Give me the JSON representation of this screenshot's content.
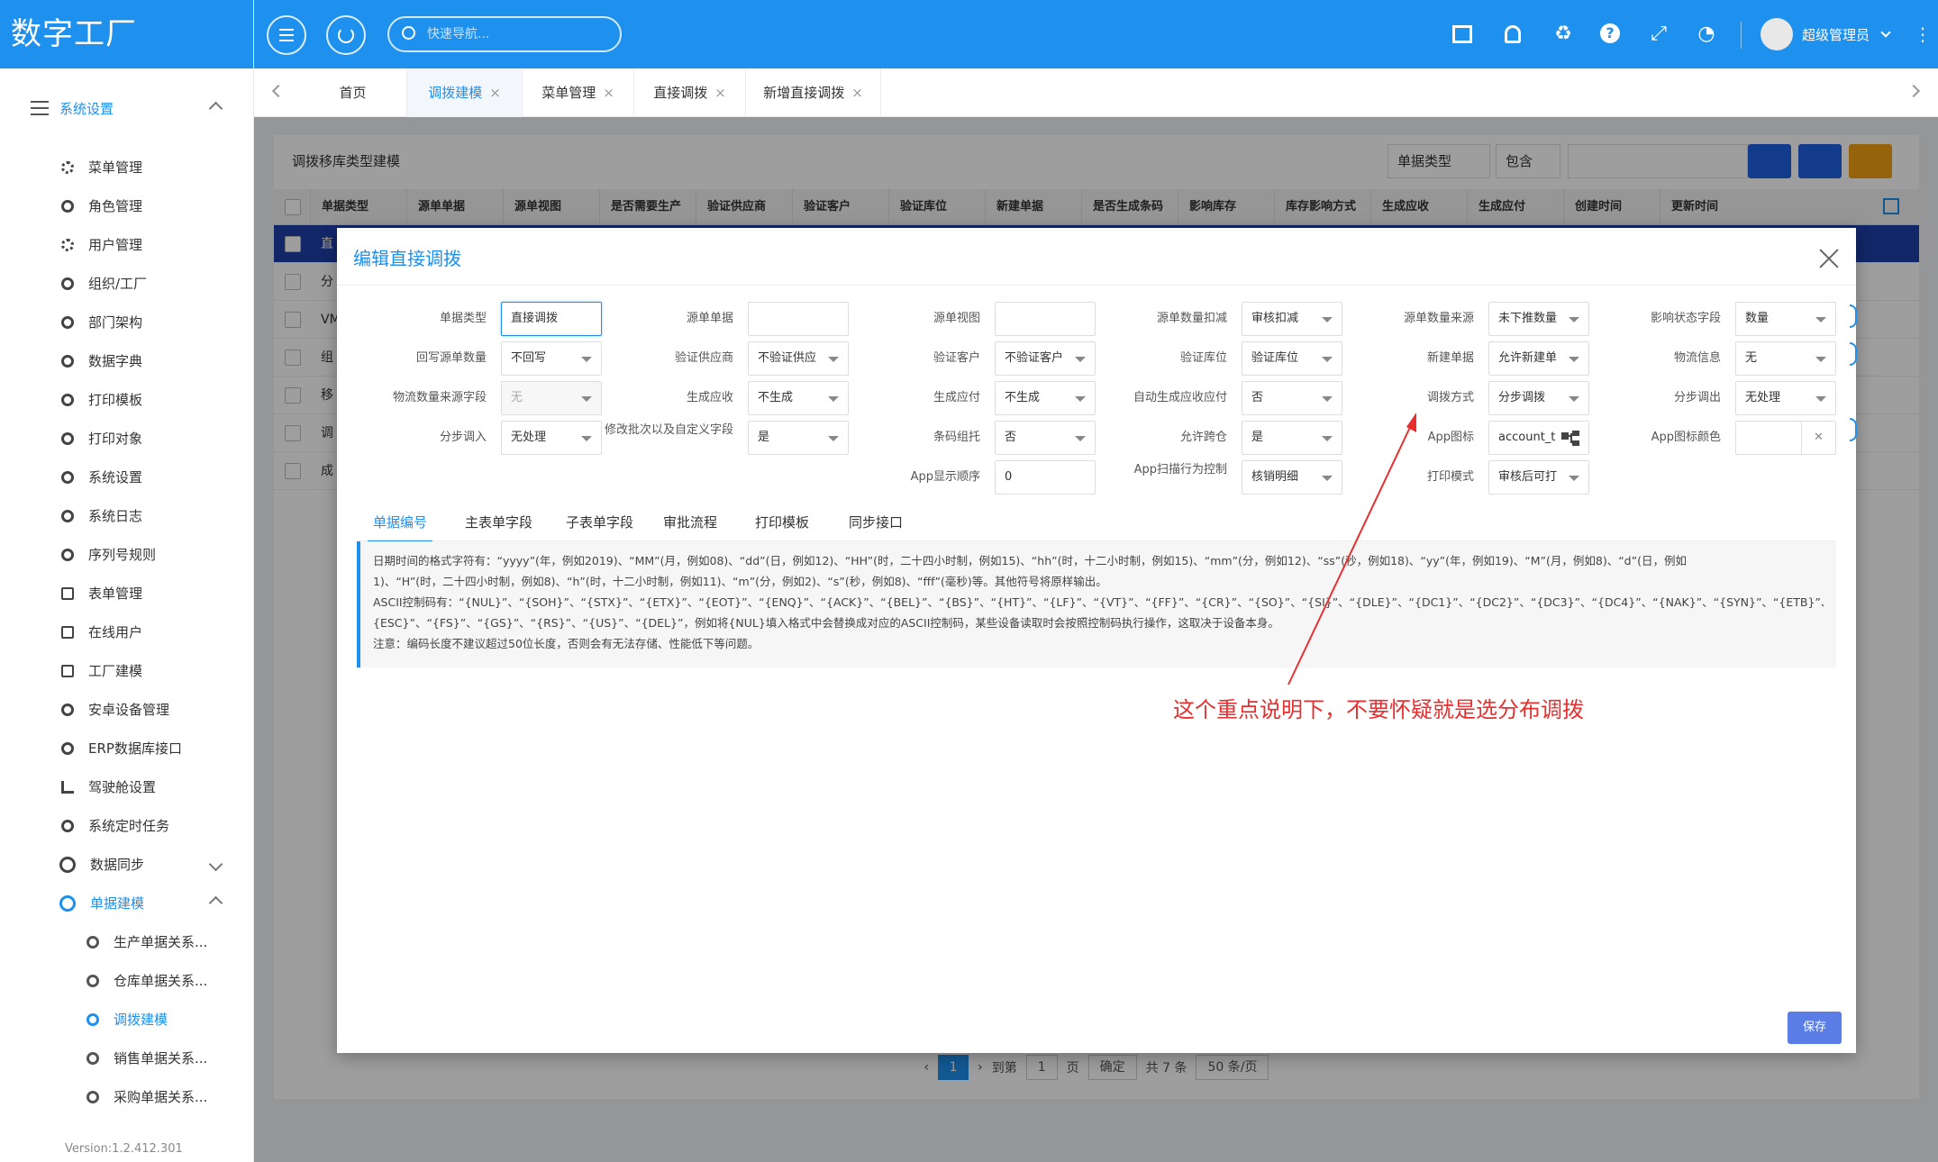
{
  "app": {
    "title": "数字工厂",
    "version": "Version:1.2.412.301"
  },
  "topbar": {
    "search_placeholder": "快速导航...",
    "user_name": "超级管理员"
  },
  "sidebar": {
    "group_label": "系统设置",
    "items": [
      "菜单管理",
      "角色管理",
      "用户管理",
      "组织/工厂",
      "部门架构",
      "数据字典",
      "打印模板",
      "打印对象",
      "系统设置",
      "系统日志",
      "序列号规则",
      "表单管理",
      "在线用户",
      "工厂建模",
      "安卓设备管理",
      "ERP数据库接口",
      "驾驶舱设置",
      "系统定时任务"
    ],
    "data_sync": "数据同步",
    "doc_model": "单据建模",
    "sub_items": [
      "生产单据关系...",
      "仓库单据关系...",
      "调拨建模",
      "销售单据关系...",
      "采购单据关系..."
    ]
  },
  "tabs": [
    {
      "label": "首页",
      "closable": false
    },
    {
      "label": "调拨建模",
      "closable": true,
      "active": true
    },
    {
      "label": "菜单管理",
      "closable": true
    },
    {
      "label": "直接调拨",
      "closable": true
    },
    {
      "label": "新增直接调拨",
      "closable": true
    }
  ],
  "grid": {
    "title": "调拨移库类型建模",
    "filter_field": "单据类型",
    "filter_op": "包含",
    "columns": [
      "单据类型",
      "源单单据",
      "源单视图",
      "是否需要生产",
      "验证供应商",
      "验证客户",
      "验证库位",
      "新建单据",
      "是否生成条码",
      "影响库存",
      "库存影响方式",
      "生成应收",
      "生成应付",
      "创建时间",
      "更新时间"
    ],
    "rows": [
      "直",
      "分",
      "VM",
      "组",
      "移",
      "调",
      "成"
    ],
    "pager": {
      "page": "1",
      "goto": "到第",
      "page_unit": "页",
      "confirm": "确定",
      "total": "共 7 条",
      "page_size": "50 条/页"
    }
  },
  "modal": {
    "title": "编辑直接调拨",
    "fields": [
      {
        "label": "单据类型",
        "value": "直接调拨",
        "type": "input",
        "focus": true
      },
      {
        "label": "源单单据",
        "value": "",
        "type": "input"
      },
      {
        "label": "源单视图",
        "value": "",
        "type": "input"
      },
      {
        "label": "源单数量扣减",
        "value": "审核扣减",
        "type": "select"
      },
      {
        "label": "源单数量来源",
        "value": "未下推数量",
        "type": "select"
      },
      {
        "label": "影响状态字段",
        "value": "数量",
        "type": "select"
      },
      {
        "label": "回写源单数量",
        "value": "不回写",
        "type": "select"
      },
      {
        "label": "验证供应商",
        "value": "不验证供应",
        "type": "select"
      },
      {
        "label": "验证客户",
        "value": "不验证客户",
        "type": "select"
      },
      {
        "label": "验证库位",
        "value": "验证库位",
        "type": "select"
      },
      {
        "label": "新建单据",
        "value": "允许新建单",
        "type": "select"
      },
      {
        "label": "物流信息",
        "value": "无",
        "type": "select"
      },
      {
        "label": "物流数量来源字段",
        "value": "无",
        "type": "select",
        "disabled": true
      },
      {
        "label": "生成应收",
        "value": "不生成",
        "type": "select"
      },
      {
        "label": "生成应付",
        "value": "不生成",
        "type": "select"
      },
      {
        "label": "自动生成应收应付",
        "value": "否",
        "type": "select"
      },
      {
        "label": "调拨方式",
        "value": "分步调拨",
        "type": "select"
      },
      {
        "label": "分步调出",
        "value": "无处理",
        "type": "select"
      },
      {
        "label": "分步调入",
        "value": "无处理",
        "type": "select"
      },
      {
        "label": "修改批次以及自定义字段",
        "value": "是",
        "type": "select"
      },
      {
        "label": "条码组托",
        "value": "否",
        "type": "select"
      },
      {
        "label": "允许跨仓",
        "value": "是",
        "type": "select"
      },
      {
        "label": "App图标",
        "value": "account_t",
        "type": "tree"
      },
      {
        "label": "App图标颜色",
        "value": "",
        "type": "color"
      },
      {
        "label": "App显示顺序",
        "value": "0",
        "type": "input"
      },
      {
        "label": "App扫描行为控制",
        "value": "核销明细",
        "type": "select"
      },
      {
        "label": "打印模式",
        "value": "审核后可打",
        "type": "select"
      }
    ],
    "inner_tabs": [
      "单据编号",
      "主表单字段",
      "子表单字段",
      "审批流程",
      "打印模板",
      "同步接口"
    ],
    "note_lines": [
      "日期时间的格式字符有：“yyyy”(年，例如2019)、“MM”(月，例如08)、“dd”(日，例如12)、“HH”(时，二十四小时制，例如15)、“hh”(时，十二小时制，例如15)、“mm”(分，例如12)、“ss”(秒，例如18)、“yy”(年，例如19)、“M”(月，例如8)、“d”(日，例如",
      "1)、“H”(时，二十四小时制，例如8)、“h”(时，十二小时制，例如11)、“m”(分，例如2)、“s”(秒，例如8)、“fff”(毫秒)等。其他符号将原样输出。",
      "ASCII控制码有：“{NUL}”、“{SOH}”、“{STX}”、“{ETX}”、“{EOT}”、“{ENQ}”、“{ACK}”、“{BEL}”、“{BS}”、“{HT}”、“{LF}”、“{VT}”、“{FF}”、“{CR}”、“{SO}”、“{SI}”、“{DLE}”、“{DC1}”、“{DC2}”、“{DC3}”、“{DC4}”、“{NAK}”、“{SYN}”、“{ETB}”、“{CAN}”、“{EM}”、“{SUB}”、“",
      "{ESC}”、“{FS}”、“{GS}”、“{RS}”、“{US}”、“{DEL}”，例如将{NUL}填入格式中会替换成对应的ASCII控制码，某些设备读取时会按照控制码执行操作，这取决于设备本身。",
      "注意：编码长度不建议超过50位长度，否则会有无法存储、性能低下等问题。"
    ],
    "save_label": "保存"
  },
  "annotation": {
    "text": "这个重点说明下，不要怀疑就是选分布调拨",
    "color": "#e63030"
  },
  "colors": {
    "primary": "#1e90ee",
    "annotation": "#e63030",
    "save": "#5a7ee6"
  }
}
